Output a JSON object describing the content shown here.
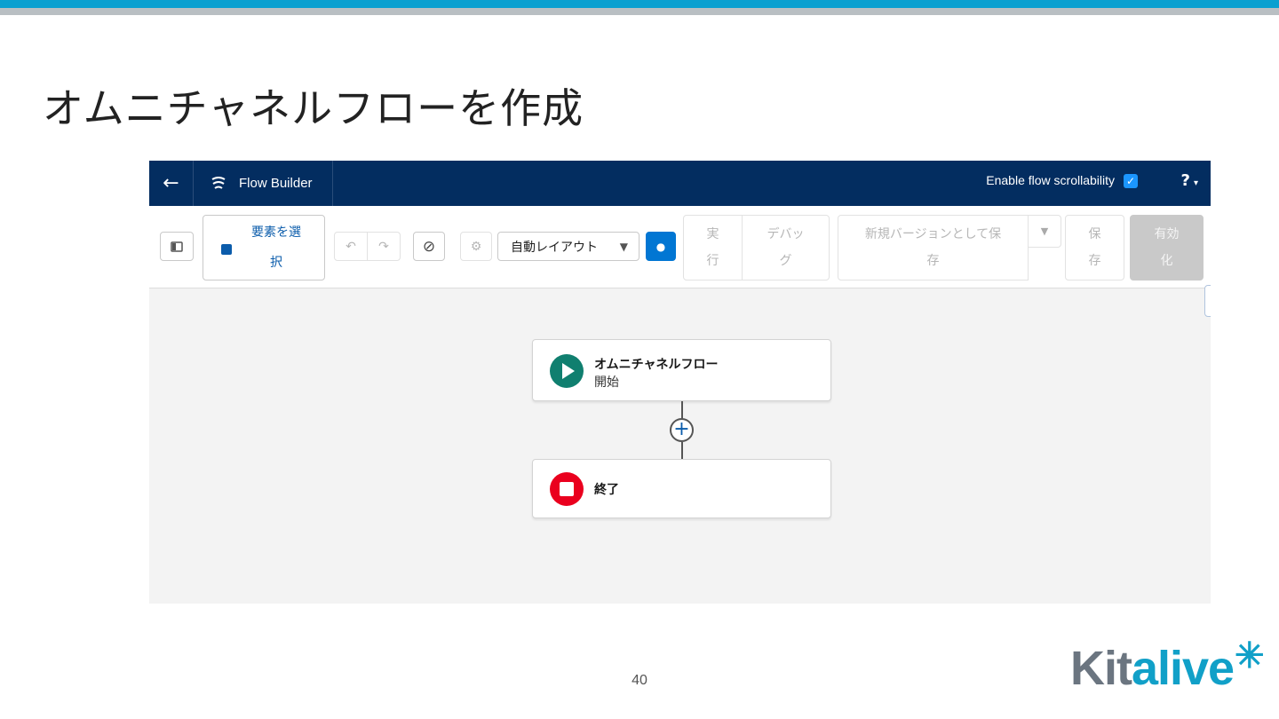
{
  "slide": {
    "title": "オムニチャネルフローを作成",
    "page_number": "40",
    "logo": "Kitalive*"
  },
  "header": {
    "back_icon": "arrow-left-icon",
    "app_title": "Flow Builder",
    "scroll_label": "Enable flow scrollability",
    "scroll_checked": true,
    "help_label": "?"
  },
  "toolbar": {
    "select_elements": "要素を選択",
    "select_elements_line1": "要素を選",
    "select_elements_line2": "択",
    "layout_select": "自動レイアウト",
    "run_l1": "実",
    "run_l2": "行",
    "debug_l1": "デバッ",
    "debug_l2": "グ",
    "save_as_l1": "新規バージョンとして保",
    "save_as_l2": "存",
    "save_l1": "保",
    "save_l2": "存",
    "activate_l1": "有効",
    "activate_l2": "化"
  },
  "canvas": {
    "start_node": {
      "title": "オムニチャネルフロー",
      "subtitle": "開始"
    },
    "end_node": {
      "title": "終了"
    }
  },
  "colors": {
    "header_bg": "#032d60",
    "start_icon": "#107f6f",
    "end_icon": "#ea001e",
    "accent_blue": "#0176d3"
  }
}
